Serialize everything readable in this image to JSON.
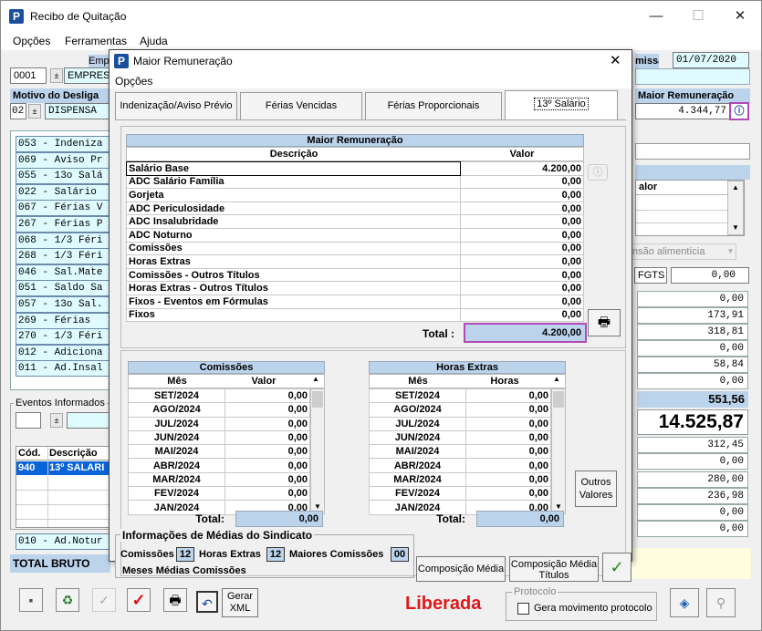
{
  "main": {
    "title": "Recibo de Quitação",
    "menu": [
      "Opções",
      "Ferramentas",
      "Ajuda"
    ],
    "empresa_label": "Empr",
    "empresa_code": "0001",
    "empresa_name": "EMPRESA",
    "admissao_label": "missão:",
    "admissao_date": "01/07/2020",
    "motivo_label": "Motivo do Desliga",
    "motivo_code": "02",
    "motivo_text": "DISPENSA",
    "maior_rem_label": "Maior Remuneração",
    "maior_rem_value": "4.344,77",
    "event_list": [
      "053 - Indeniza",
      "069 - Aviso Pr",
      "055 - 13o Salá",
      "022 - Salário",
      "067 - Férias V",
      "267 - Férias P",
      "068 - 1/3 Féri",
      "268 - 1/3 Féri",
      "046 - Sal.Mate",
      "051 - Saldo Sa",
      "057 - 13o Sal.",
      "269 - Férias",
      "270 - 1/3 Féri",
      "012 - Adiciona",
      "011 - Ad.Insal"
    ],
    "eventos_label": "Eventos Informados",
    "cod_header": "Cód.",
    "descricao_header": "Descrição",
    "evento_code": "940",
    "evento_desc": "13º SALARI",
    "adnot_row": "010 - Ad.Notur",
    "total_bruto_label": "TOTAL BRUTO",
    "right_valor_header": "alor",
    "pensao_label": "nsão alimentícia",
    "fgts_label": "FGTS",
    "fgts_value": "0,00",
    "right_values": [
      "0,00",
      "173,91",
      "318,81",
      "0,00",
      "58,84",
      "0,00"
    ],
    "right_total": "551,56",
    "big_total": "14.525,87",
    "right_values2": [
      "312,45",
      "0,00",
      "280,00",
      "236,98",
      "0,00",
      "0,00"
    ],
    "status": "Liberada",
    "gerar_xml": "Gerar XML",
    "protocolo_label": "Protocolo",
    "gera_mov_label": "Gera movimento protocolo"
  },
  "modal": {
    "title": "Maior Remuneração",
    "menu": "Opções",
    "tabs": [
      "Indenização/Aviso Prévio",
      "Férias Vencidas",
      "Férias Proporcionais",
      "13º Salário"
    ],
    "grid_title": "Maior Remuneração",
    "col_descricao": "Descrição",
    "col_valor": "Valor",
    "rows": [
      {
        "desc": "Salário Base",
        "valor": "4.200,00"
      },
      {
        "desc": "ADC Salário Família",
        "valor": "0,00"
      },
      {
        "desc": "Gorjeta",
        "valor": "0,00"
      },
      {
        "desc": "ADC Periculosidade",
        "valor": "0,00"
      },
      {
        "desc": "ADC Insalubridade",
        "valor": "0,00"
      },
      {
        "desc": "ADC Noturno",
        "valor": "0,00"
      },
      {
        "desc": "Comissões",
        "valor": "0,00"
      },
      {
        "desc": "Horas Extras",
        "valor": "0,00"
      },
      {
        "desc": "Comissões - Outros Títulos",
        "valor": "0,00"
      },
      {
        "desc": "Horas Extras - Outros Títulos",
        "valor": "0,00"
      },
      {
        "desc": "Fixos - Eventos em Fórmulas",
        "valor": "0,00"
      },
      {
        "desc": "Fixos",
        "valor": "0,00"
      }
    ],
    "total_label": "Total :",
    "total_value": "4.200,00",
    "comissoes": {
      "title": "Comissões",
      "col_mes": "Mês",
      "col_valor": "Valor",
      "rows": [
        {
          "mes": "SET/2024",
          "v": "0,00"
        },
        {
          "mes": "AGO/2024",
          "v": "0,00"
        },
        {
          "mes": "JUL/2024",
          "v": "0,00"
        },
        {
          "mes": "JUN/2024",
          "v": "0,00"
        },
        {
          "mes": "MAI/2024",
          "v": "0,00"
        },
        {
          "mes": "ABR/2024",
          "v": "0,00"
        },
        {
          "mes": "MAR/2024",
          "v": "0,00"
        },
        {
          "mes": "FEV/2024",
          "v": "0,00"
        },
        {
          "mes": "JAN/2024",
          "v": "0,00"
        }
      ],
      "total_label": "Total:",
      "total_value": "0,00"
    },
    "horas": {
      "title": "Horas Extras",
      "col_mes": "Mês",
      "col_horas": "Horas",
      "rows": [
        {
          "mes": "SET/2024",
          "v": "0,00"
        },
        {
          "mes": "AGO/2024",
          "v": "0,00"
        },
        {
          "mes": "JUL/2024",
          "v": "0,00"
        },
        {
          "mes": "JUN/2024",
          "v": "0,00"
        },
        {
          "mes": "MAI/2024",
          "v": "0,00"
        },
        {
          "mes": "ABR/2024",
          "v": "0,00"
        },
        {
          "mes": "MAR/2024",
          "v": "0,00"
        },
        {
          "mes": "FEV/2024",
          "v": "0,00"
        },
        {
          "mes": "JAN/2024",
          "v": "0,00"
        }
      ],
      "total_label": "Total:",
      "total_value": "0,00"
    },
    "outros_valores": "Outros Valores",
    "medias": {
      "title": "Informações de Médias do Sindicato",
      "comissoes_label": "Comissões",
      "comissoes_value": "12",
      "horas_label": "Horas Extras",
      "horas_value": "12",
      "maiores_label": "Maiores Comissões",
      "maiores_value": "00",
      "meses_label": "Meses Médias Comissões"
    },
    "composicao_media": "Composição Média",
    "composicao_media_titulos": "Composição Média Títulos"
  }
}
